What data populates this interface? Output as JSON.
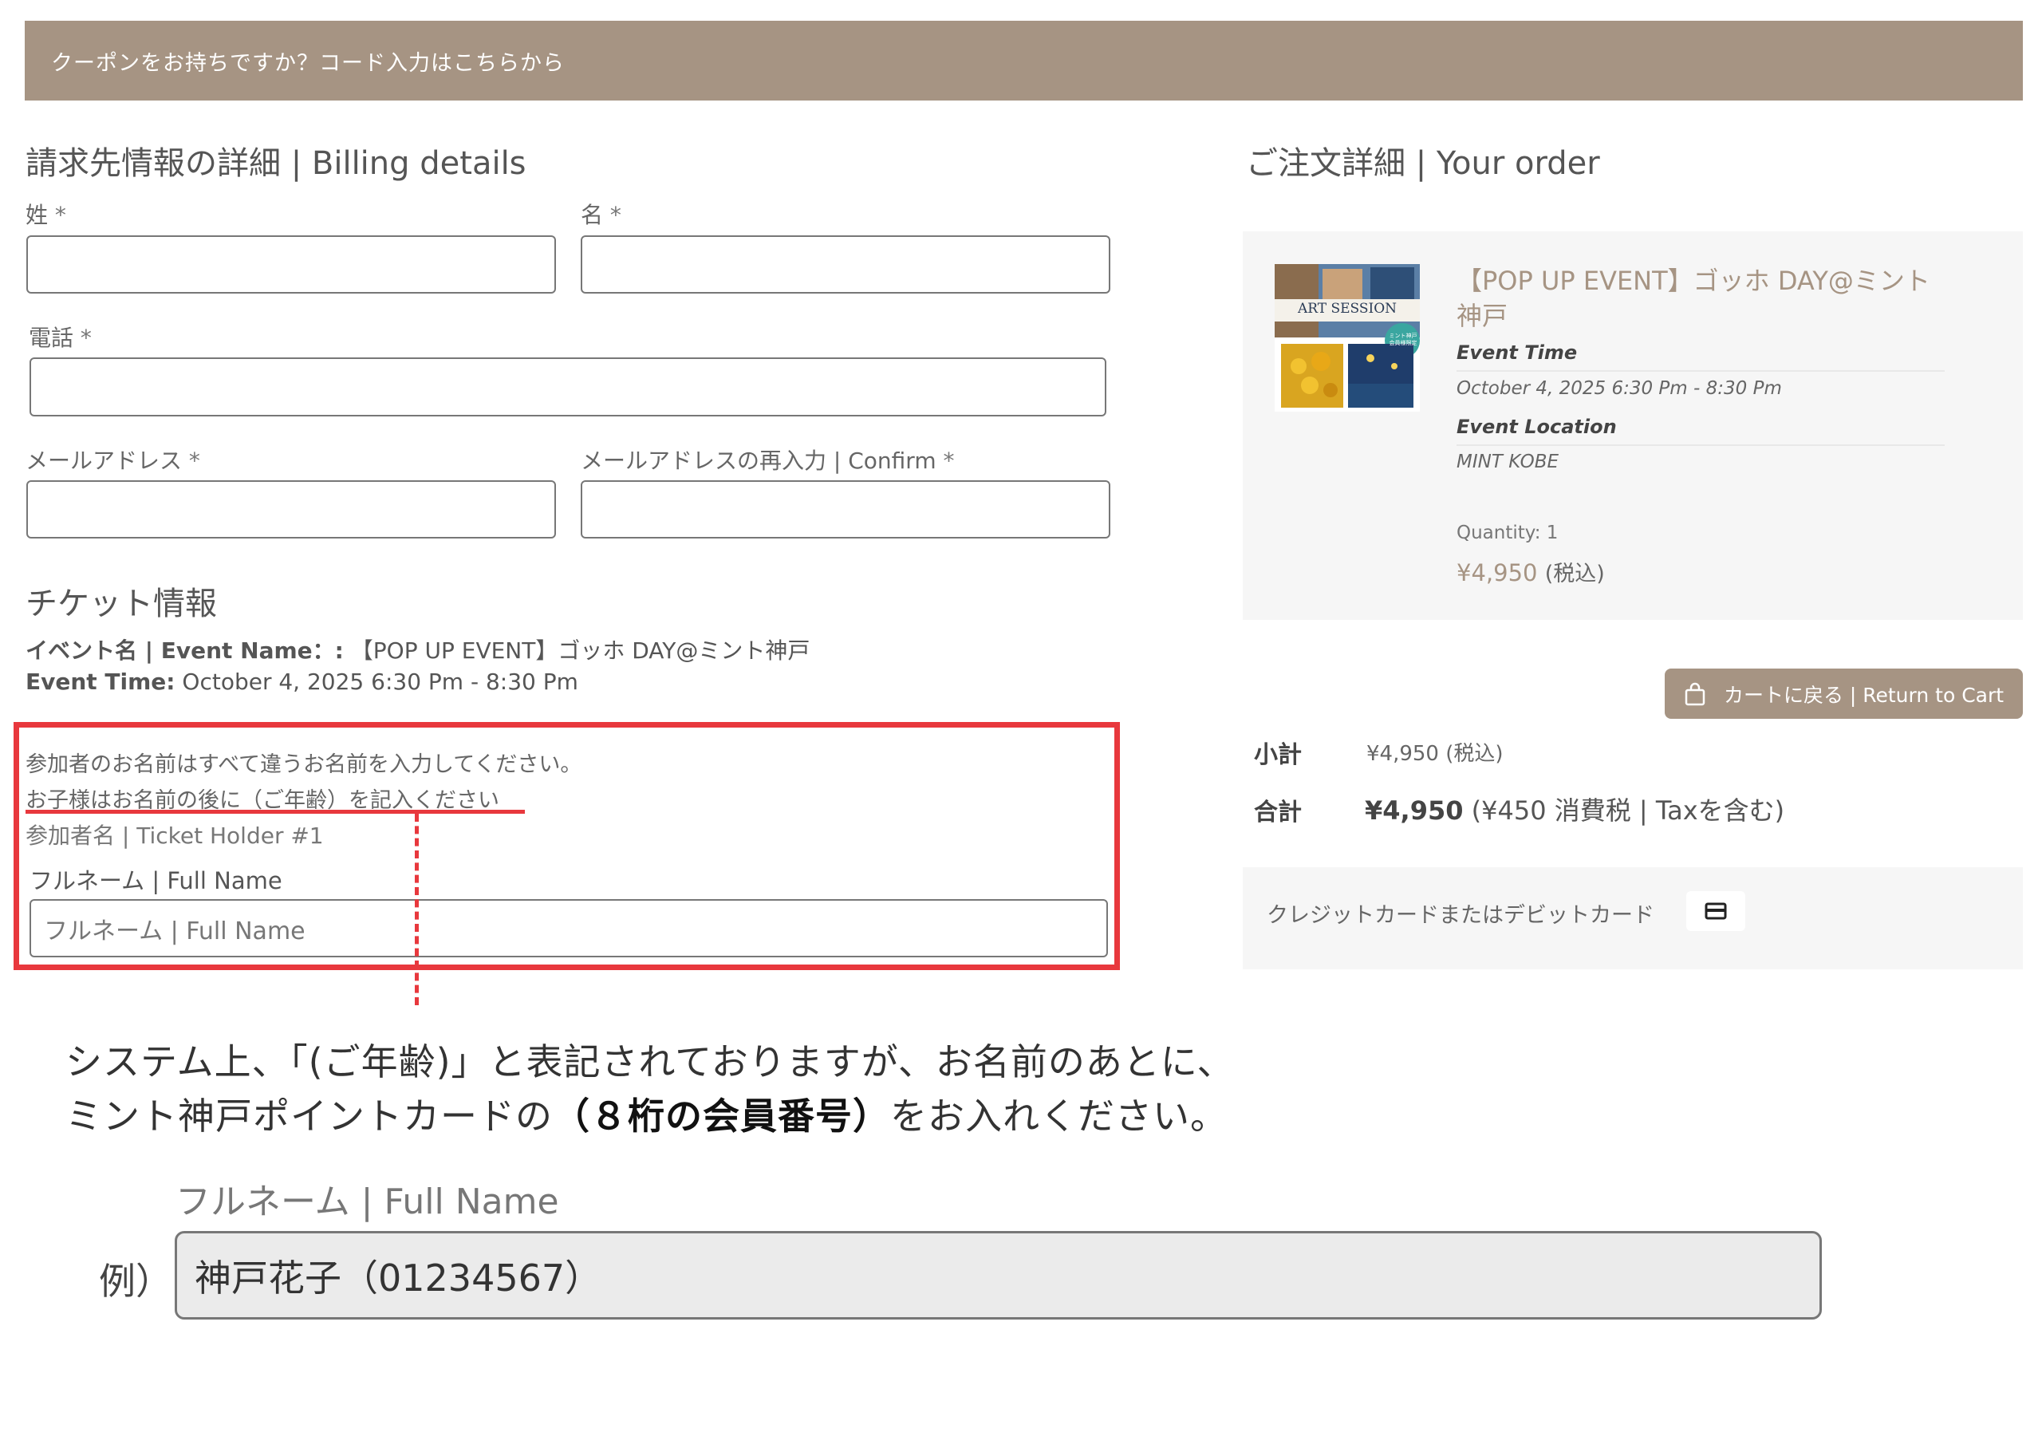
{
  "coupon_bar": {
    "text": "クーポンをお持ちですか？コード入力はこちらから"
  },
  "billing": {
    "title": "請求先情報の詳細 | Billing details",
    "last_name_label": "姓",
    "first_name_label": "名",
    "phone_label": "電話",
    "email_label": "メールアドレス",
    "email_confirm_label": "メールアドレスの再入力 | Confirm",
    "required_mark": "*"
  },
  "ticket": {
    "title": "チケット情報",
    "event_name_label": "イベント名 | Event Name：:",
    "event_name_value": "【POP UP EVENT】ゴッホ DAY@ミント神戸",
    "event_time_label": "Event Time:",
    "event_time_value": "October 4, 2025 6:30 Pm - 8:30 Pm",
    "notice_line1": "参加者のお名前はすべて違うお名前を入力してください。",
    "notice_line2": "お子様はお名前の後に（ご年齢）を記入ください",
    "holder_label": "参加者名 | Ticket Holder #1",
    "full_name_label": "フルネーム | Full Name",
    "full_name_placeholder": "フルネーム | Full Name"
  },
  "order": {
    "title": "ご注文詳細 | Your order",
    "product_title": "【POP UP EVENT】ゴッホ DAY@ミント神戸",
    "thumbnail_text": "ART SESSION",
    "thumbnail_badge": "ミント神戸 会員様限定",
    "event_time_label": "Event Time",
    "event_time_value": "October 4, 2025 6:30 Pm - 8:30 Pm",
    "event_location_label": "Event Location",
    "event_location_value": "MINT KOBE",
    "quantity": "Quantity: 1",
    "price": "¥4,950",
    "price_tax_note": "(税込)",
    "return_to_cart": "カートに戻る | Return to Cart",
    "subtotal_label": "小計",
    "subtotal_value": "¥4,950 (税込)",
    "total_label": "合計",
    "total_value": "¥4,950",
    "total_tax_note": "(¥450 消費税 | Taxを含む)",
    "payment_method": "クレジットカードまたはデビットカード"
  },
  "annotation": {
    "note_line1": "システム上、「(ご年齢)」と表記されておりますが、お名前のあとに、",
    "note_line2_prefix": "ミント神戸ポイントカードの",
    "note_line2_bold": "（８桁の会員番号）",
    "note_line2_suffix": "をお入れください。",
    "example_field_label": "フルネーム | Full Name",
    "example_prefix": "例）",
    "example_value": "神戸花子（01234567）"
  },
  "colors": {
    "accent": "#a69483",
    "highlight_red": "#e8383d",
    "panel_bg": "#f6f6f6"
  }
}
